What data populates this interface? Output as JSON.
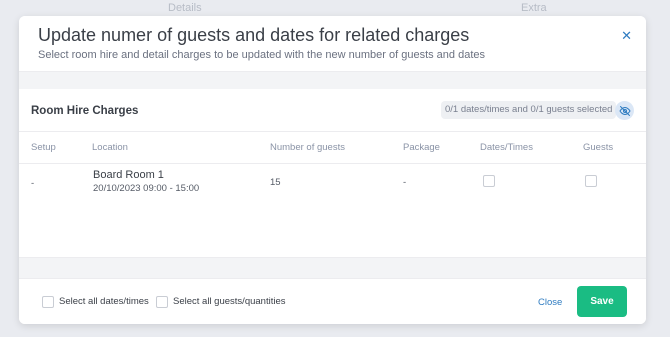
{
  "background": {
    "tabs": [
      "Details",
      "Extra"
    ]
  },
  "modal": {
    "title": "Update numer of guests and dates for related charges",
    "subtitle": "Select room hire and detail charges to be updated with the new number of guests and dates",
    "close_icon": "close-icon"
  },
  "section": {
    "title": "Room Hire Charges",
    "selected_summary": "0/1 dates/times and 0/1 guests selected",
    "toggle_icon": "eye-off-icon",
    "columns": [
      "Setup",
      "Location",
      "Number of guests",
      "Package",
      "Dates/Times",
      "Guests"
    ],
    "rows": [
      {
        "setup": "-",
        "location": "Board Room 1",
        "datetime": "20/10/2023 09:00 - 15:00",
        "guests": "15",
        "package": "-",
        "dates_checked": false,
        "guests_checked": false
      }
    ]
  },
  "footer": {
    "select_all_dates": "Select all dates/times",
    "select_all_guests": "Select all guests/quantities",
    "close_label": "Close",
    "save_label": "Save"
  },
  "colors": {
    "accent_blue": "#2f7cc1",
    "save_green": "#1abc83"
  }
}
